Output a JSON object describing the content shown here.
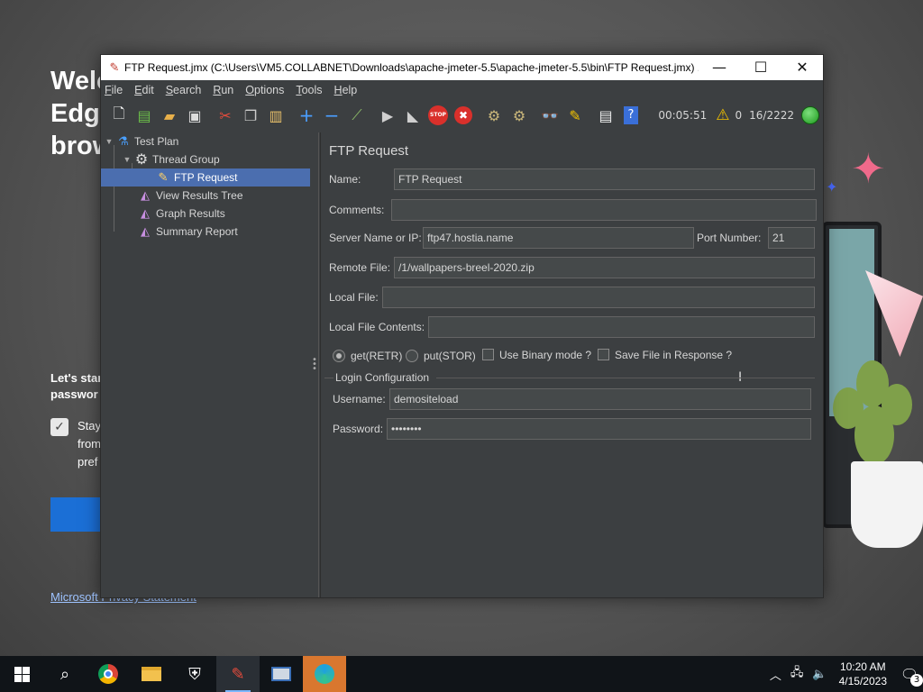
{
  "background": {
    "welcome_lines": [
      "Welc",
      "Edge",
      "brow"
    ],
    "lets_start_lines": [
      "Let's star",
      "passwor"
    ],
    "stay_lines": [
      "Stay",
      "from",
      "pref"
    ],
    "privacy_link": "Microsoft Privacy Statement"
  },
  "window": {
    "title": "FTP Request.jmx (C:\\Users\\VM5.COLLABNET\\Downloads\\apache-jmeter-5.5\\apache-jmeter-5.5\\bin\\FTP Request.jmx) ...",
    "minimize": "—",
    "maximize": "☐",
    "close": "✕"
  },
  "menu": [
    "File",
    "Edit",
    "Search",
    "Run",
    "Options",
    "Tools",
    "Help"
  ],
  "toolbar": {
    "icons": [
      "new-icon",
      "templates-icon",
      "open-icon",
      "save-icon",
      "cut-icon",
      "copy-icon",
      "paste-icon",
      "expand-icon",
      "collapse-icon",
      "toggle-icon",
      "start-icon",
      "start-no-pauses-icon",
      "stop-icon",
      "shutdown-icon",
      "clear-icon",
      "clear-all-icon",
      "search-icon",
      "reset-search-icon",
      "function-helper-icon",
      "help-icon"
    ],
    "elapsed": "00:05:51",
    "warning_count": "0",
    "threads": "16/2222"
  },
  "tree": {
    "items": [
      {
        "label": "Test Plan",
        "icon": "test-plan-icon"
      },
      {
        "label": "Thread Group",
        "icon": "gear-icon"
      },
      {
        "label": "FTP Request",
        "icon": "sampler-icon"
      },
      {
        "label": "View Results Tree",
        "icon": "listener-icon"
      },
      {
        "label": "Graph Results",
        "icon": "listener-icon"
      },
      {
        "label": "Summary Report",
        "icon": "listener-icon"
      }
    ]
  },
  "form": {
    "title": "FTP Request",
    "name_label": "Name:",
    "name_value": "FTP Request",
    "comments_label": "Comments:",
    "comments_value": "",
    "server_label": "Server Name or IP:",
    "server_value": "ftp47.hostia.name",
    "port_label": "Port Number:",
    "port_value": "21",
    "remote_label": "Remote File:",
    "remote_value": "/1/wallpapers-breel-2020.zip",
    "local_label": "Local File:",
    "local_value": "",
    "contents_label": "Local File Contents:",
    "contents_value": "",
    "get_label": "get(RETR)",
    "put_label": "put(STOR)",
    "binary_label": "Use Binary mode ?",
    "save_label": "Save File in Response ?",
    "login_group": "Login Configuration",
    "username_label": "Username:",
    "username_value": "demositeload",
    "password_label": "Password:",
    "password_value": "••••••••"
  },
  "taskbar": {
    "time": "10:20 AM",
    "date": "4/15/2023",
    "notifications": "3"
  }
}
